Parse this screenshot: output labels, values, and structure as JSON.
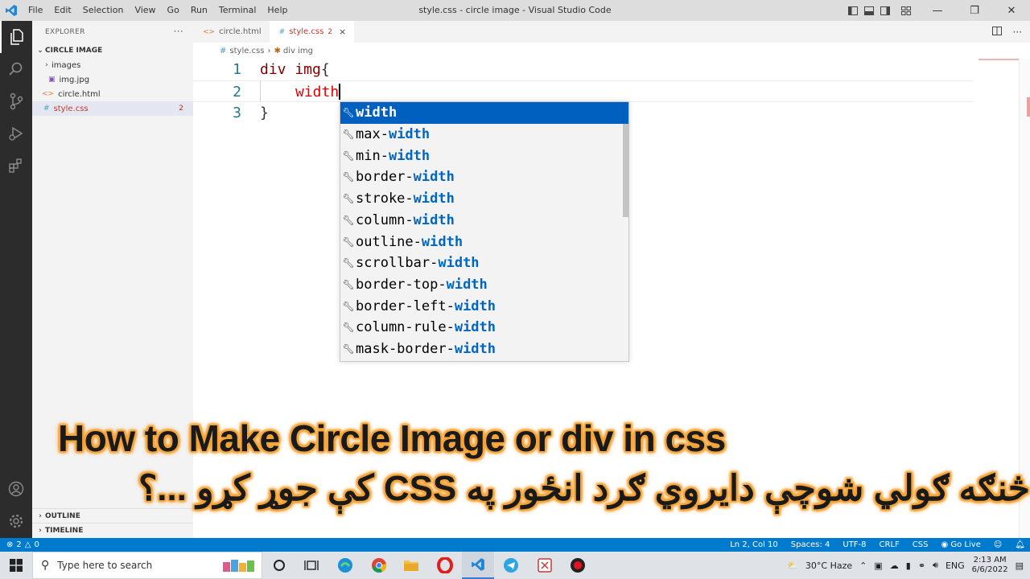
{
  "window": {
    "title": "style.css - circle image - Visual Studio Code",
    "menu": [
      "File",
      "Edit",
      "Selection",
      "View",
      "Go",
      "Run",
      "Terminal",
      "Help"
    ]
  },
  "explorer": {
    "header": "EXPLORER",
    "more": "···",
    "folder": "CIRCLE IMAGE",
    "items": [
      {
        "label": "images",
        "type": "folder"
      },
      {
        "label": "img.jpg",
        "type": "image"
      },
      {
        "label": "circle.html",
        "type": "html"
      },
      {
        "label": "style.css",
        "type": "css",
        "errors": "2"
      }
    ],
    "outline": "OUTLINE",
    "timeline": "TIMELINE"
  },
  "tabs": [
    {
      "label": "circle.html",
      "icon": "<>"
    },
    {
      "label": "style.css",
      "icon": "#",
      "badge": "2",
      "close": "×"
    }
  ],
  "breadcrumbs": {
    "file": "style.css",
    "symbol": "div img"
  },
  "editor": {
    "lines": [
      {
        "num": "1",
        "selector": "div img",
        "brace": "{"
      },
      {
        "num": "2",
        "prop": "width"
      },
      {
        "num": "3",
        "brace": "}"
      }
    ]
  },
  "suggestions": [
    {
      "prefix": "",
      "match": "width"
    },
    {
      "prefix": "max-",
      "match": "width"
    },
    {
      "prefix": "min-",
      "match": "width"
    },
    {
      "prefix": "border-",
      "match": "width"
    },
    {
      "prefix": "stroke-",
      "match": "width"
    },
    {
      "prefix": "column-",
      "match": "width"
    },
    {
      "prefix": "outline-",
      "match": "width"
    },
    {
      "prefix": "scrollbar-",
      "match": "width"
    },
    {
      "prefix": "border-top-",
      "match": "width"
    },
    {
      "prefix": "border-left-",
      "match": "width"
    },
    {
      "prefix": "column-rule-",
      "match": "width"
    },
    {
      "prefix": "mask-border-",
      "match": "width"
    }
  ],
  "overlay": {
    "title_en": "How to Make Circle Image or div in css",
    "title_ps": "څنګه ګولي شوچې دايروي ګرد انځور په CSS کې جوړ کړو ...؟"
  },
  "status": {
    "errors": "2",
    "warnings": "0",
    "position": "Ln 2, Col 10",
    "spaces": "Spaces: 4",
    "encoding": "UTF-8",
    "eol": "CRLF",
    "language": "CSS",
    "golive": "Go Live"
  },
  "taskbar": {
    "search_placeholder": "Type here to search",
    "weather": "30°C Haze",
    "lang": "ENG",
    "time": "2:13 AM",
    "date": "6/6/2022"
  }
}
